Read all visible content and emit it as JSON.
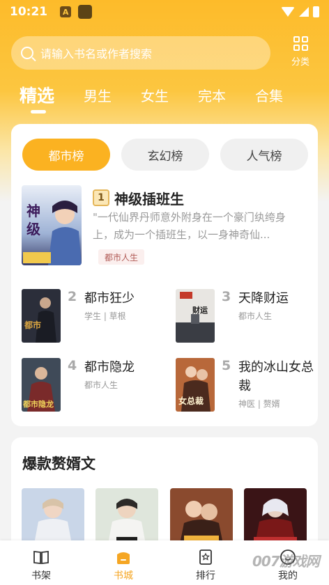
{
  "status_bar": {
    "time": "10:21",
    "app_icon_letter": "A"
  },
  "search": {
    "placeholder": "请输入书名或作者搜索"
  },
  "category_button": {
    "label": "分类",
    "icon": "grid-icon"
  },
  "tabs": [
    "精选",
    "男生",
    "女生",
    "完本",
    "合集"
  ],
  "active_tab_index": 0,
  "ranking": {
    "tabs": [
      "都市榜",
      "玄幻榜",
      "人气榜"
    ],
    "active_tab_index": 0,
    "featured": {
      "rank": "1",
      "title": "神级插班生",
      "description": "\"一代仙界丹师意外附身在一个豪门纨绔身上，成为一个插班生，以一身神奇仙...",
      "tag": "都市人生",
      "cover_text": "神级插班生"
    },
    "books": [
      {
        "rank": "2",
        "title": "都市狂少",
        "meta": "学生 | 草根",
        "cover_text": "都市狂少"
      },
      {
        "rank": "3",
        "title": "天降财运",
        "meta": "都市人生",
        "cover_text": "天降财运"
      },
      {
        "rank": "4",
        "title": "都市隐龙",
        "meta": "都市人生",
        "cover_text": "都市隐龙"
      },
      {
        "rank": "5",
        "title": "我的冰山女总裁",
        "meta": "神医 | 赘婿",
        "cover_text": "我的冰山女总裁"
      }
    ]
  },
  "hot_section": {
    "title": "爆款赘婿文"
  },
  "bottom_nav": [
    {
      "label": "书架",
      "icon": "bookshelf-icon"
    },
    {
      "label": "书城",
      "icon": "bookstore-icon"
    },
    {
      "label": "排行",
      "icon": "ranking-icon"
    },
    {
      "label": "我的",
      "icon": "profile-icon"
    }
  ],
  "active_nav_index": 1,
  "watermark": "007游戏网",
  "colors": {
    "accent": "#fbb221",
    "header": "#fcc640",
    "active_nav": "#f5a623"
  }
}
